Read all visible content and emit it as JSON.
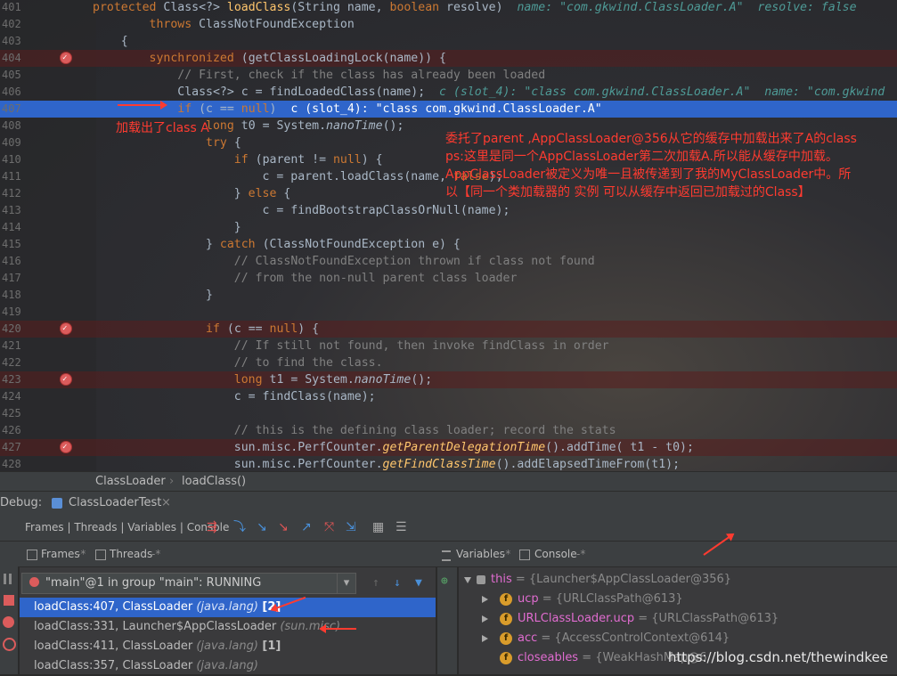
{
  "editor": {
    "lines": [
      {
        "n": "401",
        "html": "<span class=\"kw\">protected </span>Class&lt;?&gt; <span class=\"fn\">loadClass</span>(String name, <span class=\"kw\">boolean </span>resolve)  <span class=\"hint\">name: \"com.gkwind.ClassLoader.A\"  resolve: false</span>",
        "indent": "    "
      },
      {
        "n": "402",
        "html": "        <span class=\"kw\">throws </span>ClassNotFoundException"
      },
      {
        "n": "403",
        "html": "    {"
      },
      {
        "n": "404",
        "html": "        <span class=\"kw\">synchronized </span>(getClassLoadingLock(name)) {",
        "bp": true
      },
      {
        "n": "405",
        "html": "            <span class=\"cm\">// First, check if the class has already been loaded</span>"
      },
      {
        "n": "406",
        "html": "            Class&lt;?&gt; c = findLoadedClass(name);  <span class=\"hint\">c (slot_4): \"class com.gkwind.ClassLoader.A\"  name: \"com.gkwind</span>"
      },
      {
        "n": "407",
        "html": "            <span class=\"kw\">if </span>(c == <span class=\"kw\">null</span>)  <span style=\"color:#fff\">c (slot_4): \"class com.gkwind.ClassLoader.A\"</span>",
        "cur": true
      },
      {
        "n": "408",
        "html": "                <span class=\"kw\">long </span>t0 = System.<span class=\"it\">nanoTime</span>();"
      },
      {
        "n": "409",
        "html": "                <span class=\"kw\">try </span>{"
      },
      {
        "n": "410",
        "html": "                    <span class=\"kw\">if </span>(parent != <span class=\"kw\">null</span>) {"
      },
      {
        "n": "411",
        "html": "                        c = parent.loadClass(name, <span class=\"kw\">false</span>);"
      },
      {
        "n": "412",
        "html": "                    } <span class=\"kw\">else </span>{"
      },
      {
        "n": "413",
        "html": "                        c = findBootstrapClassOrNull(name);"
      },
      {
        "n": "414",
        "html": "                    }"
      },
      {
        "n": "415",
        "html": "                } <span class=\"kw\">catch </span>(ClassNotFoundException e) {"
      },
      {
        "n": "416",
        "html": "                    <span class=\"cm\">// ClassNotFoundException thrown if class not found</span>"
      },
      {
        "n": "417",
        "html": "                    <span class=\"cm\">// from the non-null parent class loader</span>"
      },
      {
        "n": "418",
        "html": "                }"
      },
      {
        "n": "419",
        "html": ""
      },
      {
        "n": "420",
        "html": "                <span class=\"kw\">if </span>(c == <span class=\"kw\">null</span>) {",
        "bp": true
      },
      {
        "n": "421",
        "html": "                    <span class=\"cm\">// If still not found, then invoke findClass in order</span>"
      },
      {
        "n": "422",
        "html": "                    <span class=\"cm\">// to find the class.</span>"
      },
      {
        "n": "423",
        "html": "                    <span class=\"kw\">long </span>t1 = System.<span class=\"it\">nanoTime</span>();",
        "bp": true
      },
      {
        "n": "424",
        "html": "                    c = findClass(name);"
      },
      {
        "n": "425",
        "html": ""
      },
      {
        "n": "426",
        "html": "                    <span class=\"cm\">// this is the defining class loader; record the stats</span>"
      },
      {
        "n": "427",
        "html": "                    sun.misc.PerfCounter.<span class=\"it2\">getParentDelegationTime</span>().addTime( t1 - t0);",
        "bp": true
      },
      {
        "n": "428",
        "html": "                    sun.misc.PerfCounter.<span class=\"it2\">getFindClassTime</span>().addElapsedTimeFrom(t1);"
      }
    ],
    "annotation_left": "加载出了class A",
    "annotation_lines": [
      "委托了parent ,AppClassLoader@356从它的缓存中加载出来了A的class",
      "ps:这里是同一个AppClassLoader第二次加载A.所以能从缓存中加载。",
      "AppClassLoader被定义为唯一且被传递到了我的MyClassLoader中。所",
      "以【同一个类加载器的 实例 可以从缓存中返回已加载过的Class】"
    ]
  },
  "breadcrumb": {
    "class": "ClassLoader",
    "sep": "›",
    "method": "loadClass()"
  },
  "debug": {
    "label": "Debug:",
    "config": "ClassLoaderTest",
    "close": "×",
    "toolbar_label": "Frames | Threads | Variables | Console",
    "tabs": {
      "frames": "Frames",
      "threads": "Threads",
      "variables": "Variables",
      "console": "Console"
    },
    "thread_select": "\"main\"@1 in group \"main\": RUNNING",
    "frames": [
      {
        "method": "loadClass:407, ClassLoader ",
        "pkg": "(java.lang)",
        "suffix": " [2]",
        "sel": true
      },
      {
        "method": "loadClass:331, Launcher$AppClassLoader ",
        "pkg": "(sun.misc)",
        "suffix": ""
      },
      {
        "method": "loadClass:411, ClassLoader ",
        "pkg": "(java.lang)",
        "suffix": " [1]"
      },
      {
        "method": "loadClass:357, ClassLoader ",
        "pkg": "(java.lang)",
        "suffix": ""
      }
    ],
    "variables": [
      {
        "name": "this",
        "value": " = {Launcher$AppClassLoader@356}",
        "badge": "",
        "tri": "open"
      },
      {
        "name": "ucp",
        "value": " = {URLClassPath@613}",
        "badge": "f",
        "tri": "closed"
      },
      {
        "name": "URLClassLoader.ucp",
        "value": " = {URLClassPath@613}",
        "badge": "f",
        "tri": "closed"
      },
      {
        "name": "acc",
        "value": " = {AccessControlContext@614}",
        "badge": "f",
        "tri": "closed"
      },
      {
        "name": "closeables",
        "value": " = {WeakHashMap@6",
        "badge": "f",
        "tri": "none"
      }
    ]
  },
  "watermark": "https://blog.csdn.net/thewindkee"
}
